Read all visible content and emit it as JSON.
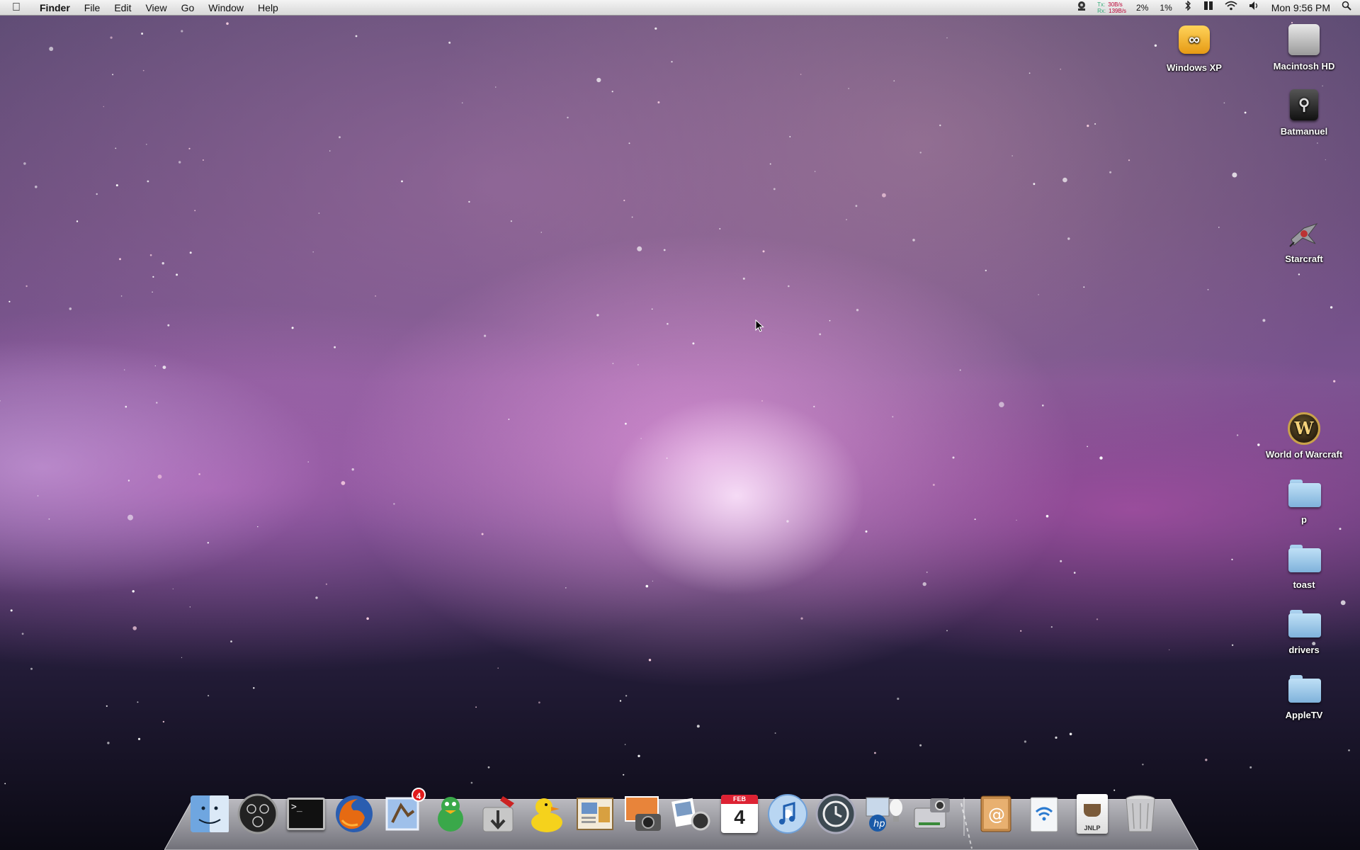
{
  "menubar": {
    "apple_glyph": "",
    "app_name": "Finder",
    "menus": [
      "File",
      "Edit",
      "View",
      "Go",
      "Window",
      "Help"
    ],
    "network": {
      "tx_label": "Tx:",
      "rx_label": "Rx:",
      "tx_value": "30B/s",
      "rx_value": "139B/s"
    },
    "cpu_percent_1": "2%",
    "cpu_percent_2": "1%",
    "clock": "Mon 9:56 PM"
  },
  "desktop_icons": [
    {
      "label": "Windows XP",
      "icon": "parallels-icon"
    },
    {
      "label": "Macintosh HD",
      "icon": "hard-drive-icon"
    },
    {
      "label": "Batmanuel",
      "icon": "usb-drive-icon"
    },
    {
      "label": "Starcraft",
      "icon": "starcraft-alias-icon"
    },
    {
      "label": "World of Warcraft",
      "icon": "wow-alias-icon"
    },
    {
      "label": "p",
      "icon": "folder-icon"
    },
    {
      "label": "toast",
      "icon": "folder-icon"
    },
    {
      "label": "drivers",
      "icon": "folder-icon"
    },
    {
      "label": "AppleTV",
      "icon": "folder-icon"
    }
  ],
  "dock": {
    "apps": [
      {
        "name": "finder-icon"
      },
      {
        "name": "dashboard-icon"
      },
      {
        "name": "terminal-icon",
        "text": ">_"
      },
      {
        "name": "firefox-icon"
      },
      {
        "name": "mail-icon",
        "badge": "4"
      },
      {
        "name": "adium-icon"
      },
      {
        "name": "transmit-icon"
      },
      {
        "name": "cyberduck-icon"
      },
      {
        "name": "preview-icon"
      },
      {
        "name": "iphoto-icon"
      },
      {
        "name": "photo-booth-icon"
      },
      {
        "name": "ical-icon",
        "month": "FEB",
        "day": "4"
      },
      {
        "name": "itunes-icon"
      },
      {
        "name": "time-machine-icon"
      },
      {
        "name": "hp-utility-icon"
      },
      {
        "name": "image-capture-icon"
      }
    ],
    "docs": [
      {
        "name": "address-book-icon"
      },
      {
        "name": "airport-utility-icon"
      },
      {
        "name": "jnlp-file-icon",
        "label": "JNLP"
      },
      {
        "name": "trash-icon"
      }
    ]
  },
  "colors": {
    "menubar": "#e6e6e6",
    "folder": "#9cc8ea",
    "badge": "#e21b1b"
  }
}
